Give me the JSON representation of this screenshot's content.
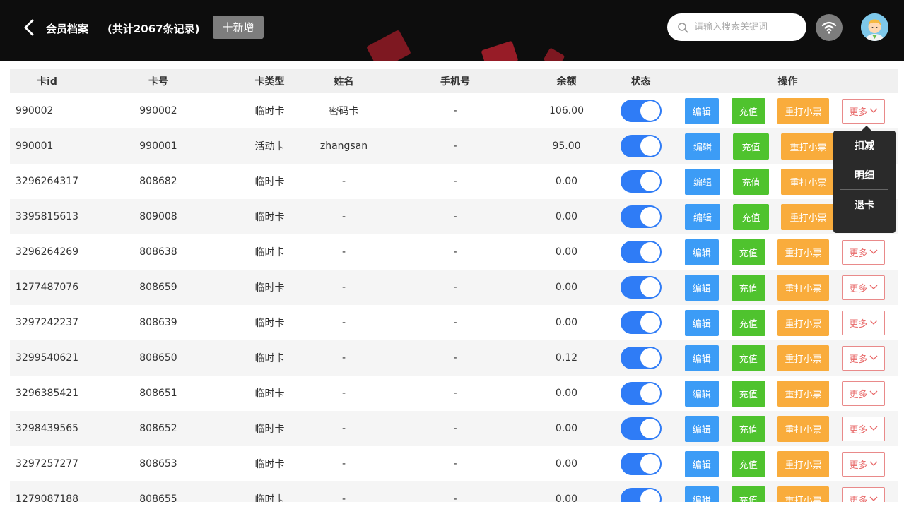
{
  "header": {
    "title": "会员档案",
    "count": "(共计2067条记录)",
    "add_label": "十新增",
    "search_placeholder": "请输入搜索关键词"
  },
  "icons": {
    "back": "chevron-left-icon",
    "search": "search-icon",
    "wifi": "wifi-icon",
    "avatar": "avatar-icon",
    "more_caret": "chevron-down-icon"
  },
  "colors": {
    "header_bg": "#0d0d0d",
    "switch_on": "#2f7cf6",
    "edit": "#3c9cf6",
    "charge": "#4fc32e",
    "print": "#f9ac3c",
    "more_border": "#e98a8a"
  },
  "table": {
    "columns": [
      "卡id",
      "卡号",
      "卡类型",
      "姓名",
      "手机号",
      "余额",
      "状态",
      "操作"
    ],
    "rows": [
      {
        "card_id": "990002",
        "card_no": "990002",
        "type": "临时卡",
        "name": "密码卡",
        "phone": "-",
        "balance": "106.00",
        "enabled": true
      },
      {
        "card_id": "990001",
        "card_no": "990001",
        "type": "活动卡",
        "name": "zhangsan",
        "phone": "-",
        "balance": "95.00",
        "enabled": true
      },
      {
        "card_id": "3296264317",
        "card_no": "808682",
        "type": "临时卡",
        "name": "-",
        "phone": "-",
        "balance": "0.00",
        "enabled": true
      },
      {
        "card_id": "3395815613",
        "card_no": "809008",
        "type": "临时卡",
        "name": "-",
        "phone": "-",
        "balance": "0.00",
        "enabled": true
      },
      {
        "card_id": "3296264269",
        "card_no": "808638",
        "type": "临时卡",
        "name": "-",
        "phone": "-",
        "balance": "0.00",
        "enabled": true
      },
      {
        "card_id": "1277487076",
        "card_no": "808659",
        "type": "临时卡",
        "name": "-",
        "phone": "-",
        "balance": "0.00",
        "enabled": true
      },
      {
        "card_id": "3297242237",
        "card_no": "808639",
        "type": "临时卡",
        "name": "-",
        "phone": "-",
        "balance": "0.00",
        "enabled": true
      },
      {
        "card_id": "3299540621",
        "card_no": "808650",
        "type": "临时卡",
        "name": "-",
        "phone": "-",
        "balance": "0.12",
        "enabled": true
      },
      {
        "card_id": "3296385421",
        "card_no": "808651",
        "type": "临时卡",
        "name": "-",
        "phone": "-",
        "balance": "0.00",
        "enabled": true
      },
      {
        "card_id": "3298439565",
        "card_no": "808652",
        "type": "临时卡",
        "name": "-",
        "phone": "-",
        "balance": "0.00",
        "enabled": true
      },
      {
        "card_id": "3297257277",
        "card_no": "808653",
        "type": "临时卡",
        "name": "-",
        "phone": "-",
        "balance": "0.00",
        "enabled": true
      },
      {
        "card_id": "1279087188",
        "card_no": "808655",
        "type": "临时卡",
        "name": "-",
        "phone": "-",
        "balance": "0.00",
        "enabled": true
      }
    ],
    "actions": {
      "edit": "编辑",
      "charge": "充值",
      "print": "重打小票",
      "more": "更多"
    }
  },
  "popup": {
    "items": [
      "扣减",
      "明细",
      "退卡"
    ]
  }
}
